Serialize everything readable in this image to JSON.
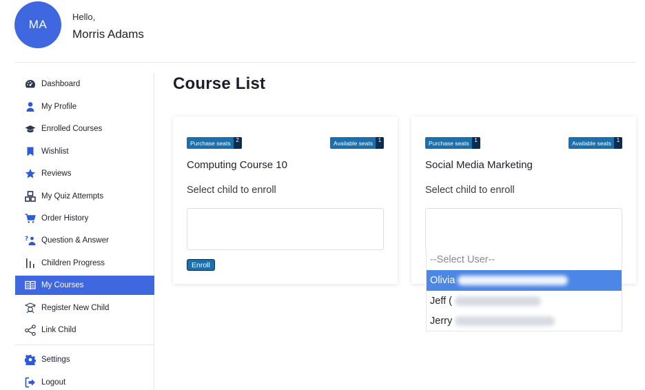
{
  "user": {
    "initials": "MA",
    "greeting": "Hello,",
    "name": "Morris Adams"
  },
  "sidebar": {
    "items": [
      {
        "label": "Dashboard",
        "icon": "dashboard-icon"
      },
      {
        "label": "My Profile",
        "icon": "user-icon"
      },
      {
        "label": "Enrolled Courses",
        "icon": "graduation-cap-icon"
      },
      {
        "label": "Wishlist",
        "icon": "bookmark-icon"
      },
      {
        "label": "Reviews",
        "icon": "star-icon"
      },
      {
        "label": "My Quiz Attempts",
        "icon": "quiz-icon"
      },
      {
        "label": "Order History",
        "icon": "cart-icon"
      },
      {
        "label": "Question & Answer",
        "icon": "question-answer-icon"
      },
      {
        "label": "Children Progress",
        "icon": "progress-bars-icon"
      },
      {
        "label": "My Courses",
        "icon": "book-icon",
        "active": true
      },
      {
        "label": "Register New Child",
        "icon": "child-cap-icon"
      },
      {
        "label": "Link Child",
        "icon": "share-icon"
      }
    ],
    "bottom": [
      {
        "label": "Settings",
        "icon": "gear-icon"
      },
      {
        "label": "Logout",
        "icon": "logout-icon"
      }
    ]
  },
  "main": {
    "title": "Course List",
    "courses": [
      {
        "name": "Computing Course 10",
        "purchase_label": "Purchase seats",
        "purchase_count": "2",
        "available_label": "Available seats",
        "available_count": "1",
        "select_label": "Select child to enroll",
        "enroll_label": "Enroll"
      },
      {
        "name": "Social Media Marketing",
        "purchase_label": "Purchase seats",
        "purchase_count": "1",
        "available_label": "Available seats",
        "available_count": "1",
        "select_label": "Select child to enroll"
      }
    ],
    "dropdown": {
      "placeholder": "--Select User--",
      "options": [
        "Olivia",
        "Jeff (",
        "Jerry"
      ],
      "selected_index": 0
    }
  },
  "colors": {
    "accent": "#3f67e0",
    "badge": "#1a6fae",
    "badge_count": "#0b2c4d",
    "option_selected": "#4d87e6"
  }
}
